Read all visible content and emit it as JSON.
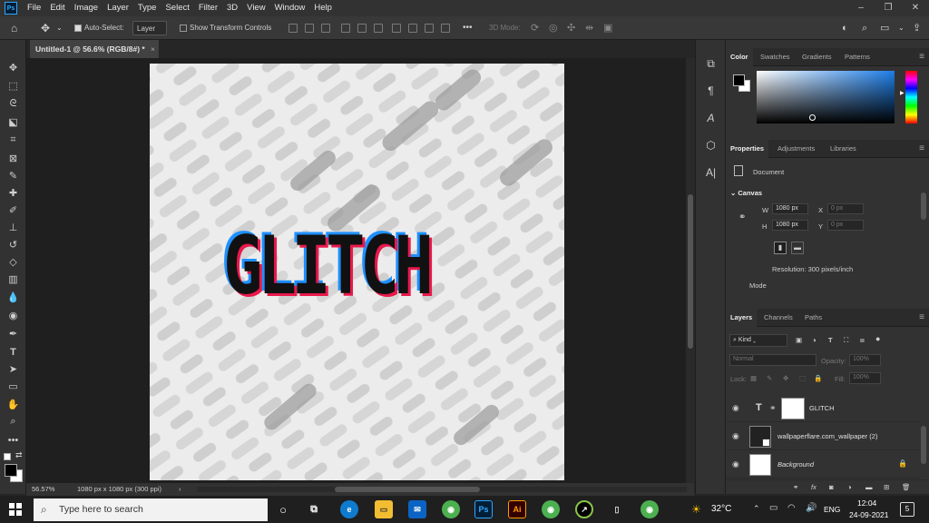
{
  "app": {
    "logo": "Ps",
    "name": "Adobe Photoshop"
  },
  "menu": [
    "File",
    "Edit",
    "Image",
    "Layer",
    "Type",
    "Select",
    "Filter",
    "3D",
    "View",
    "Window",
    "Help"
  ],
  "window_controls": {
    "minimize": "–",
    "restore": "❐",
    "close": "✕"
  },
  "options": {
    "auto_select_label": "Auto-Select:",
    "auto_select_checked": true,
    "auto_select_target": "Layer",
    "show_transform_label": "Show Transform Controls",
    "show_transform_checked": false,
    "more": "•••",
    "mode_3d_label": "3D Mode:"
  },
  "document": {
    "tab_title": "Untitled-1 @ 56.6% (RGB/8#) *",
    "close": "×"
  },
  "canvas_text": "GLITCH",
  "status": {
    "zoom": "56.57%",
    "doc_info": "1080 px x 1080 px (300 ppi)",
    "arrow": "›"
  },
  "color_panel": {
    "tabs": [
      "Color",
      "Swatches",
      "Gradients",
      "Patterns"
    ],
    "active": "Color"
  },
  "properties_panel": {
    "tabs": [
      "Properties",
      "Adjustments",
      "Libraries"
    ],
    "active": "Properties",
    "doc_label": "Document",
    "section": "Canvas",
    "w_label": "W",
    "w_value": "1080 px",
    "h_label": "H",
    "h_value": "1080 px",
    "x_label": "X",
    "x_placeholder": "0 px",
    "y_label": "Y",
    "y_placeholder": "0 px",
    "resolution": "Resolution: 300 pixels/inch",
    "mode_label": "Mode"
  },
  "layers_panel": {
    "tabs": [
      "Layers",
      "Channels",
      "Paths"
    ],
    "active": "Layers",
    "filter_kind": "Kind",
    "blend_mode": "Normal",
    "opacity_label": "Opacity:",
    "opacity_value": "100%",
    "lock_label": "Lock:",
    "fill_label": "Fill:",
    "fill_value": "100%",
    "layers": [
      {
        "name": "GLITCH",
        "type": "text",
        "italic": false
      },
      {
        "name": "wallpaperflare.com_wallpaper (2)",
        "type": "smart",
        "italic": false
      },
      {
        "name": "Background",
        "type": "background",
        "italic": true
      }
    ],
    "footer_icons": [
      "link-icon",
      "fx-icon",
      "mask-icon",
      "adjustment-icon",
      "group-icon",
      "new-layer-icon",
      "delete-icon"
    ]
  },
  "taskbar": {
    "search_placeholder": "Type here to search",
    "apps": [
      "Ps",
      "Ai"
    ],
    "weather": "32°C",
    "language": "ENG",
    "time": "12:04",
    "date": "24-09-2021",
    "notifications": "5"
  },
  "colors": {
    "brand_ps": "#31a8ff",
    "glitch_cyan": "#1e90ff",
    "glitch_red": "#e8194b",
    "canvas_bg": "#ececec"
  }
}
